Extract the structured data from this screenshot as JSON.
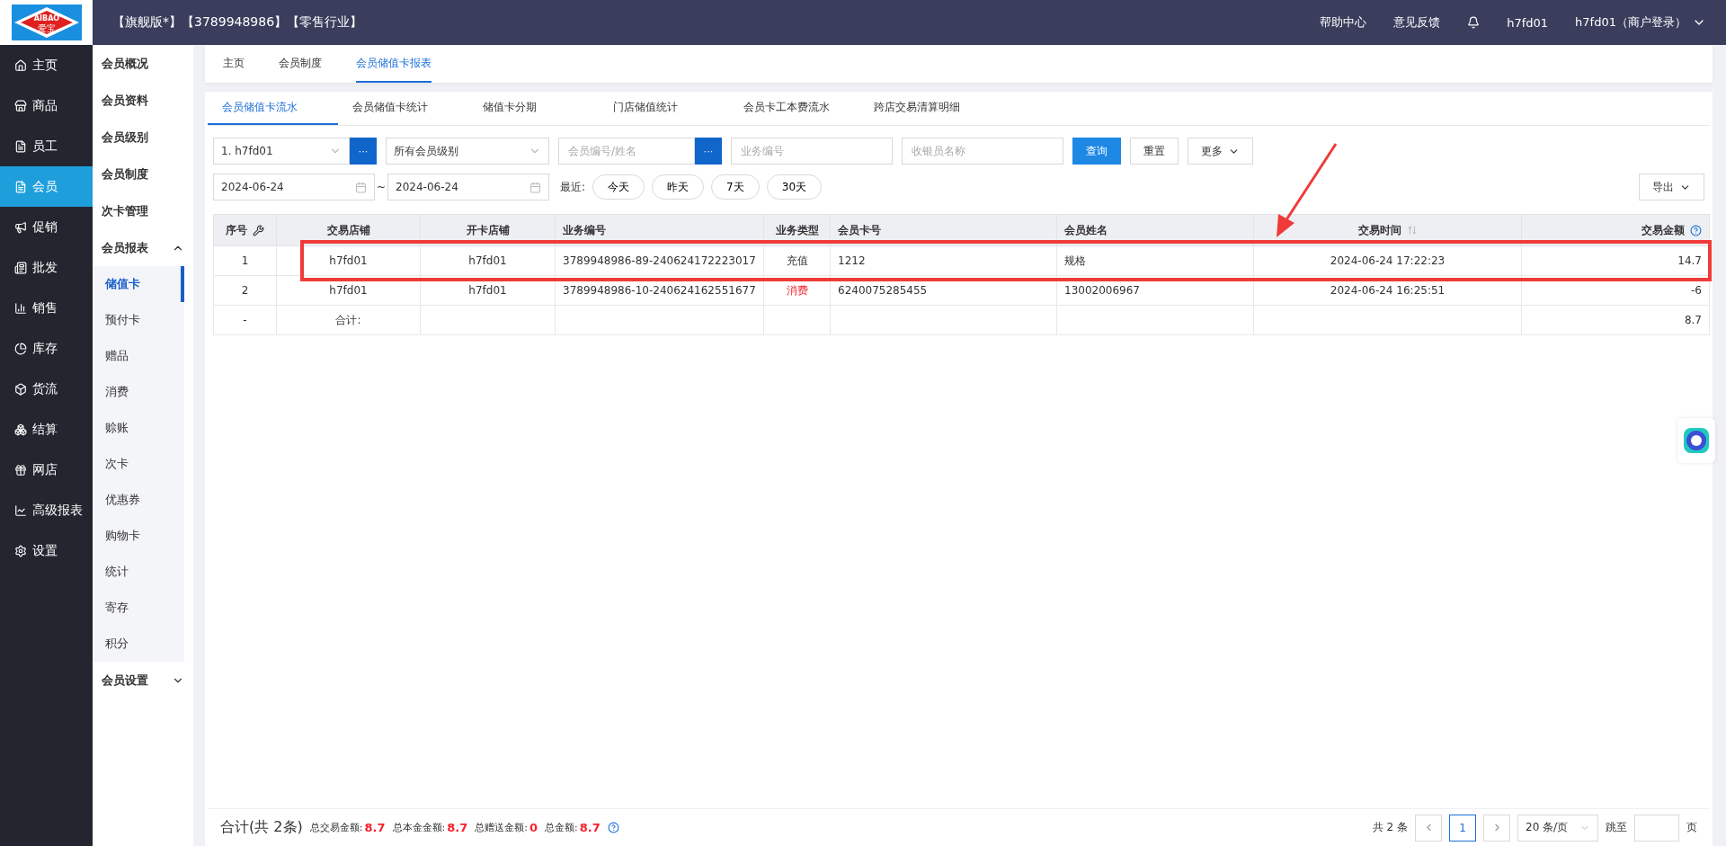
{
  "logo": {
    "text": "AIBAO",
    "subtext": "爱宝"
  },
  "header": {
    "info": "【旗舰版*】【3789948986】【零售行业】",
    "links": [
      "帮助中心",
      "意见反馈"
    ],
    "user": "h7fd01",
    "account": "h7fd01（商户登录）"
  },
  "main_nav": [
    {
      "label": "主页",
      "selected": false
    },
    {
      "label": "商品",
      "selected": false
    },
    {
      "label": "员工",
      "selected": false
    },
    {
      "label": "会员",
      "selected": true
    },
    {
      "label": "促销",
      "selected": false
    },
    {
      "label": "批发",
      "selected": false
    },
    {
      "label": "销售",
      "selected": false
    },
    {
      "label": "库存",
      "selected": false
    },
    {
      "label": "货流",
      "selected": false
    },
    {
      "label": "结算",
      "selected": false
    },
    {
      "label": "网店",
      "selected": false
    },
    {
      "label": "高级报表",
      "selected": false
    },
    {
      "label": "设置",
      "selected": false
    }
  ],
  "sub_nav": [
    {
      "label": "会员概况"
    },
    {
      "label": "会员资料"
    },
    {
      "label": "会员级别"
    },
    {
      "label": "会员制度"
    },
    {
      "label": "次卡管理"
    },
    {
      "label": "会员报表",
      "expanded": true,
      "children": [
        {
          "label": "储值卡",
          "selected": true
        },
        {
          "label": "预付卡",
          "selected": false
        },
        {
          "label": "赠品",
          "selected": false
        },
        {
          "label": "消费",
          "selected": false
        },
        {
          "label": "赊账",
          "selected": false
        },
        {
          "label": "次卡",
          "selected": false
        },
        {
          "label": "优惠券",
          "selected": false
        },
        {
          "label": "购物卡",
          "selected": false
        },
        {
          "label": "统计",
          "selected": false
        },
        {
          "label": "寄存",
          "selected": false
        },
        {
          "label": "积分",
          "selected": false
        }
      ]
    },
    {
      "label": "会员设置",
      "expanded": false
    }
  ],
  "page_tabs": [
    {
      "label": "主页",
      "selected": false
    },
    {
      "label": "会员制度",
      "selected": false
    },
    {
      "label": "会员储值卡报表",
      "selected": true
    }
  ],
  "report_tabs": [
    {
      "label": "会员储值卡流水",
      "selected": true
    },
    {
      "label": "会员储值卡统计",
      "selected": false
    },
    {
      "label": "储值卡分期",
      "selected": false
    },
    {
      "label": "门店储值统计",
      "selected": false
    },
    {
      "label": "会员卡工本费流水",
      "selected": false
    },
    {
      "label": "跨店交易清算明细",
      "selected": false
    }
  ],
  "filters": {
    "store": "1. h7fd01",
    "level": "所有会员级别",
    "member": {
      "placeholder": "会员编号/姓名"
    },
    "business_no": {
      "placeholder": "业务编号"
    },
    "cashier": {
      "placeholder": "收银员名称"
    },
    "picker_button": "···",
    "query": "查询",
    "reset": "重置",
    "more": "更多",
    "date_from": "2024-06-24",
    "date_sep": "~",
    "date_to": "2024-06-24",
    "recent_label": "最近:",
    "recent": [
      "今天",
      "昨天",
      "7天",
      "30天"
    ],
    "export": "导出"
  },
  "table": {
    "columns": [
      "序号",
      "交易店铺",
      "开卡店铺",
      "业务编号",
      "业务类型",
      "会员卡号",
      "会员姓名",
      "交易时间",
      "交易金额"
    ],
    "rows": [
      {
        "kind": "recharge",
        "cells": [
          "1",
          "h7fd01",
          "h7fd01",
          "3789948986-89-240624172223017",
          "充值",
          "1212",
          "规格",
          "2024-06-24 17:22:23",
          "14.7"
        ]
      },
      {
        "kind": "consume",
        "cells": [
          "2",
          "h7fd01",
          "h7fd01",
          "3789948986-10-240624162551677",
          "消费",
          "6240075285455",
          "13002006967",
          "2024-06-24 16:25:51",
          "-6"
        ]
      }
    ],
    "total": {
      "index": "-",
      "label": "合计:",
      "amount": "8.7"
    }
  },
  "footer": {
    "title": "合计(共 2条)",
    "stats": [
      {
        "label": "总交易金额:",
        "value": "8.7"
      },
      {
        "label": "总本金金额:",
        "value": "8.7"
      },
      {
        "label": "总赠送金额:",
        "value": "0"
      },
      {
        "label": "总金额:",
        "value": "8.7"
      }
    ],
    "count": "共 2 条",
    "page": "1",
    "page_size": "20 条/页",
    "jump_label": "跳至",
    "page_unit": "页"
  }
}
